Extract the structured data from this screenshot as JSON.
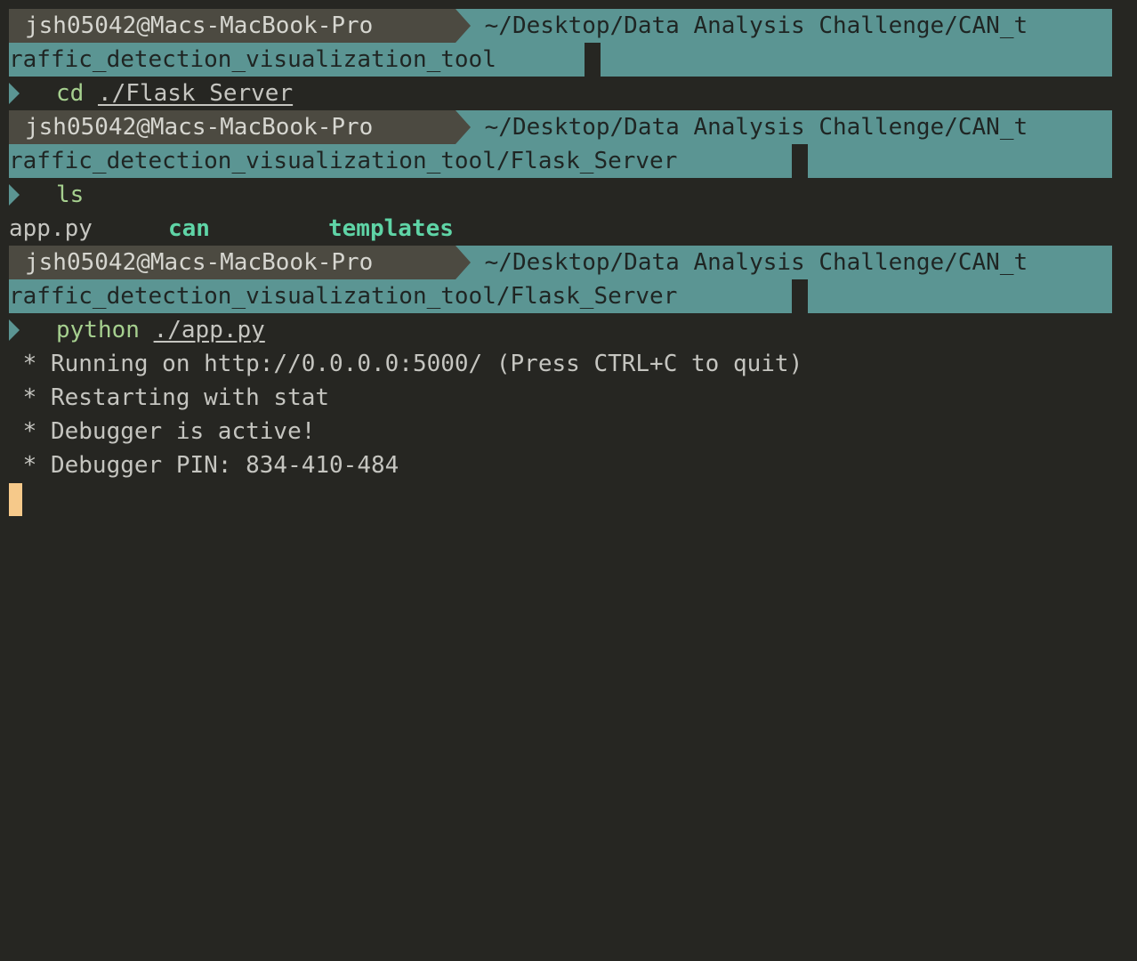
{
  "prompt": {
    "user_host": "jsh05042@Macs-MacBook-Pro",
    "cwd_root_line1": " ~/Desktop/Data Analysis Challenge/CAN_t",
    "cwd_root_line2": "raffic_detection_visualization_tool",
    "cwd_server_line2": "raffic_detection_visualization_tool/Flask_Server"
  },
  "commands": [
    {
      "cmd": "cd",
      "arg": "./Flask_Server"
    },
    {
      "cmd": "ls",
      "arg": ""
    },
    {
      "cmd": "python",
      "arg": "./app.py"
    }
  ],
  "ls_output": {
    "file": "app.py",
    "dirs": [
      "can",
      "templates"
    ]
  },
  "server_output": [
    " * Running on http://0.0.0.0:5000/ (Press CTRL+C to quit)",
    " * Restarting with stat",
    " * Debugger is active!",
    " * Debugger PIN: 834-410-484"
  ],
  "colors": {
    "background": "#262622",
    "prompt_path": "#5b9593",
    "prompt_user": "#4c4a41",
    "command": "#a6d08f",
    "directory": "#5fd4a6",
    "cursor": "#f6c98a"
  }
}
